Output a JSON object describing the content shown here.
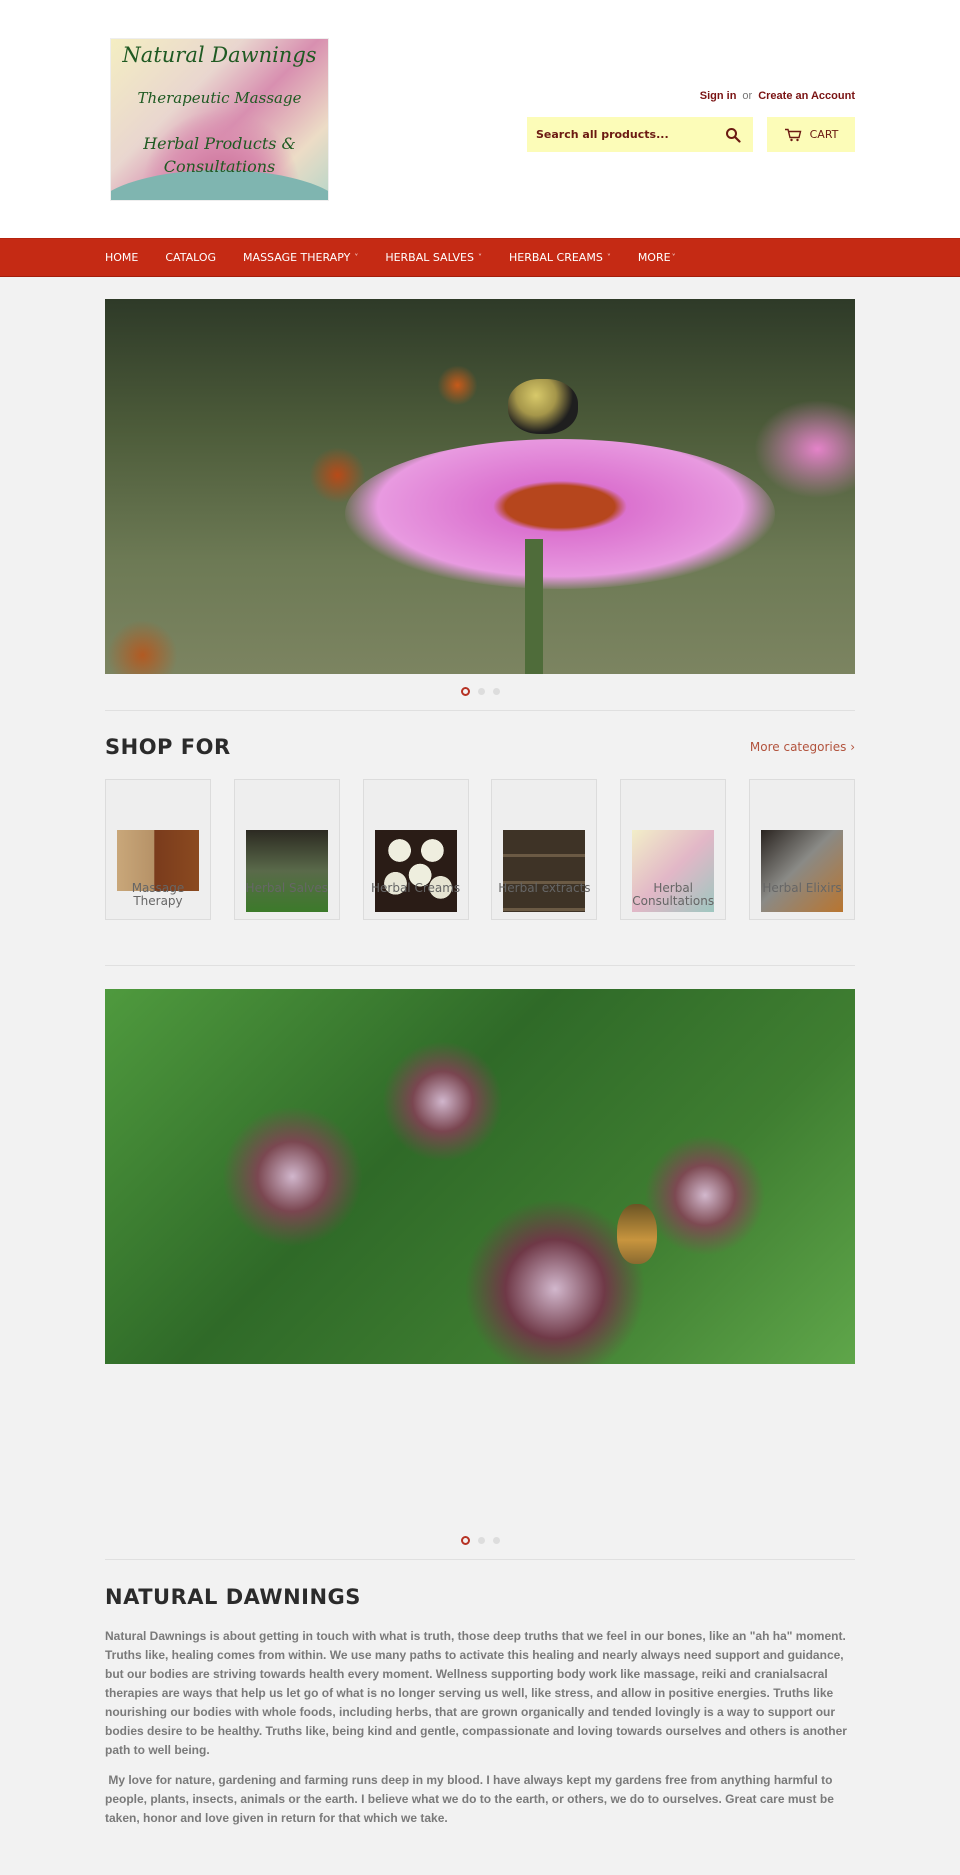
{
  "brand": {
    "logo_lines": [
      "Natural Dawnings",
      "Therapeutic Massage",
      "Herbal Products &",
      "Consultations"
    ],
    "accent_color": "#c52a14",
    "highlight_color": "#fcfcb8"
  },
  "account": {
    "sign_in": "Sign in",
    "or": "or",
    "create": "Create an Account"
  },
  "search": {
    "placeholder": "Search all products...",
    "icon": "search-icon"
  },
  "cart": {
    "label": "CART",
    "icon": "cart-icon"
  },
  "nav": {
    "items": [
      {
        "label": "HOME",
        "dropdown": false
      },
      {
        "label": "CATALOG",
        "dropdown": false
      },
      {
        "label": "MASSAGE THERAPY",
        "dropdown": true
      },
      {
        "label": "HERBAL SALVES",
        "dropdown": true
      },
      {
        "label": "HERBAL CREAMS",
        "dropdown": true
      },
      {
        "label": "MORE",
        "dropdown": true
      }
    ],
    "chevron": "˅"
  },
  "slideshow1": {
    "image_alt": "Bumblebee on purple coneflower",
    "slides": 3,
    "active_slide": 1
  },
  "shop_for": {
    "title": "SHOP FOR",
    "more_link": "More categories ›",
    "categories": [
      {
        "label": "Massage Therapy"
      },
      {
        "label": "Herbal Salves"
      },
      {
        "label": "Herbal Creams"
      },
      {
        "label": "Herbal extracts"
      },
      {
        "label": "Herbal Consultations"
      },
      {
        "label": "Herbal Elixirs"
      }
    ]
  },
  "slideshow2": {
    "image_alt": "Honeybee on flowering oregano",
    "slides": 3,
    "active_slide": 1
  },
  "about": {
    "title": "NATURAL DAWNINGS",
    "paragraphs": [
      "Natural Dawnings is about getting in touch with what is truth, those deep truths that we feel in our bones, like an \"ah ha\" moment. Truths like, healing comes from within. We use many paths to activate this healing and nearly always need support and guidance, but our bodies are striving towards health every moment. Wellness supporting body work like massage, reiki and cranialsacral therapies are ways that help us let go of what is no longer serving us well, like stress, and allow in positive energies. Truths like nourishing our bodies with whole foods, including herbs, that are grown organically and tended lovingly is a way to support our bodies desire to be healthy. Truths like, being kind and gentle, compassionate and loving towards ourselves and others is another path to well being.",
      " My love for nature, gardening and farming runs deep in my blood. I have always kept my gardens free from anything harmful to people, plants, insects, animals or the earth. I believe what we do to the earth, or others, we do to ourselves. Great care must be taken, honor and love given in return for that which we take."
    ]
  }
}
